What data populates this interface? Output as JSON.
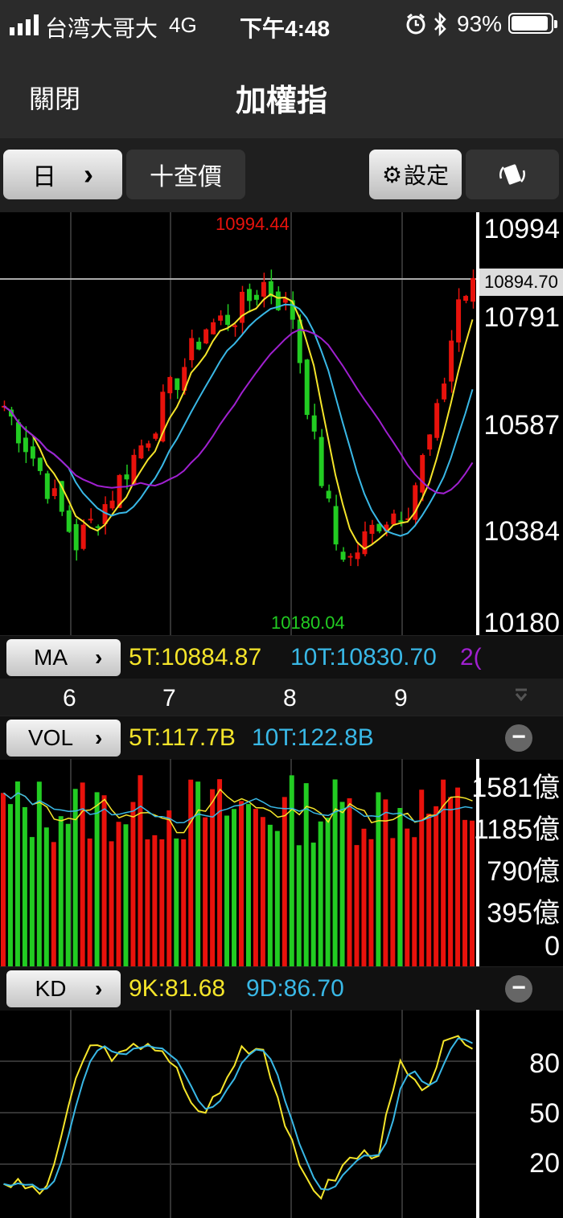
{
  "status_bar": {
    "carrier": "台湾大哥大",
    "network": "4G",
    "time": "下午4:48",
    "battery": "93%",
    "battery_level": 0.93
  },
  "nav": {
    "close_label": "關閉",
    "title": "加權指"
  },
  "toolbar": {
    "period_label": "日",
    "chevron": "›",
    "search_label": "十查價",
    "settings_label": "設定",
    "rotate_icon": "rotate-screen-icon"
  },
  "colors": {
    "up": "#e8120c",
    "down": "#22cc22",
    "ma5": "#f5e52a",
    "ma10": "#39b8e6",
    "ma20": "#a020d0"
  },
  "price_panel": {
    "axis_labels": [
      "10994",
      "10791",
      "10587",
      "10384",
      "10180"
    ],
    "current_price": "10894.70",
    "high_label": "10994.44",
    "low_label": "10180.04"
  },
  "ma_row": {
    "button": "MA",
    "ma5": "5T:10884.87",
    "ma10": "10T:10830.70",
    "ma20": "2("
  },
  "date_axis": [
    "6",
    "7",
    "8",
    "9"
  ],
  "vol_row": {
    "button": "VOL",
    "ma5": "5T:117.7B",
    "ma10": "10T:122.8B"
  },
  "vol_panel": {
    "axis_labels": [
      "1581億",
      "1185億",
      "790億",
      "395億",
      "0"
    ]
  },
  "kd_row": {
    "button": "KD",
    "k": "9K:81.68",
    "d": "9D:86.70"
  },
  "kd_panel": {
    "axis_labels": [
      "80",
      "50",
      "20"
    ]
  }
}
